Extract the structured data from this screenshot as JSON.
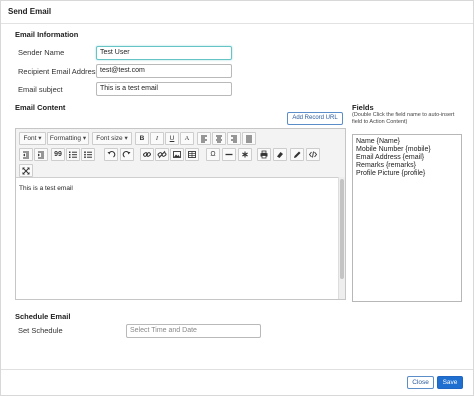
{
  "dialog": {
    "title": "Send Email"
  },
  "email_info": {
    "section_title": "Email Information",
    "sender_label": "Sender Name",
    "sender_value": "Test User",
    "recipient_label": "Recipient Email Address",
    "recipient_value": "test@test.com",
    "subject_label": "Email subject",
    "subject_value": "This is a test email"
  },
  "email_content": {
    "section_title": "Email Content",
    "add_url_label": "Add Record URL",
    "body_text": "This is a test email",
    "toolbar": {
      "font": "Font",
      "formatting": "Formatting",
      "font_size": "Font size",
      "bold": "B",
      "italic": "I",
      "underline": "U",
      "text_color": "A",
      "quote": "99",
      "special_char": "Ω"
    }
  },
  "fields": {
    "title": "Fields",
    "hint": "(Double Click the field name to auto-insert field to Action Content)",
    "items": [
      "Name {Name}",
      "Mobile Number {mobile}",
      "Email Address {email}",
      "Remarks {remarks}",
      "Profile Picture {profile}"
    ]
  },
  "schedule": {
    "section_title": "Schedule Email",
    "label": "Set Schedule",
    "placeholder": "Select Time and Date"
  },
  "footer": {
    "close_label": "Close",
    "save_label": "Save"
  }
}
